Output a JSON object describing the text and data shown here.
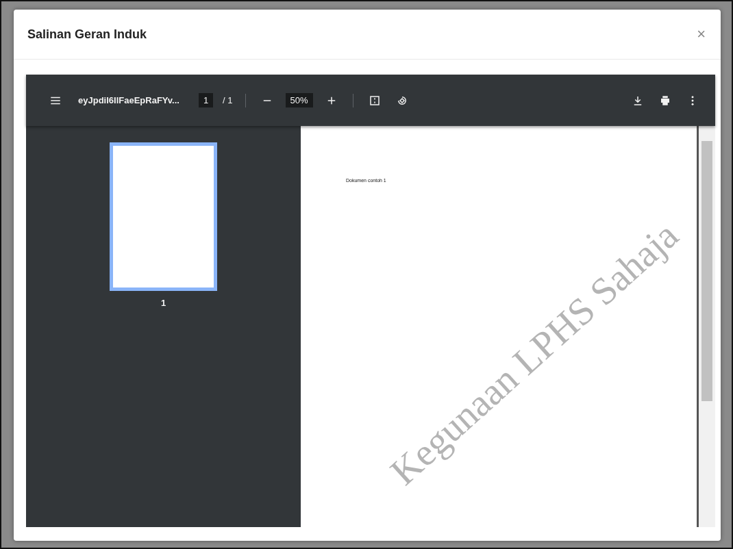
{
  "dialog": {
    "title": "Salinan Geran Induk",
    "close": "×"
  },
  "viewer": {
    "filename": "eyJpdiI6IlFaeEpRaFYv...",
    "page_input": "1",
    "page_total": "/ 1",
    "zoom": "50%",
    "thumbnails": [
      {
        "label": "1",
        "selected": true
      }
    ],
    "page": {
      "text": "Dokumen contoh 1",
      "watermark": "Kegunaan LPHS Sahaja"
    }
  }
}
